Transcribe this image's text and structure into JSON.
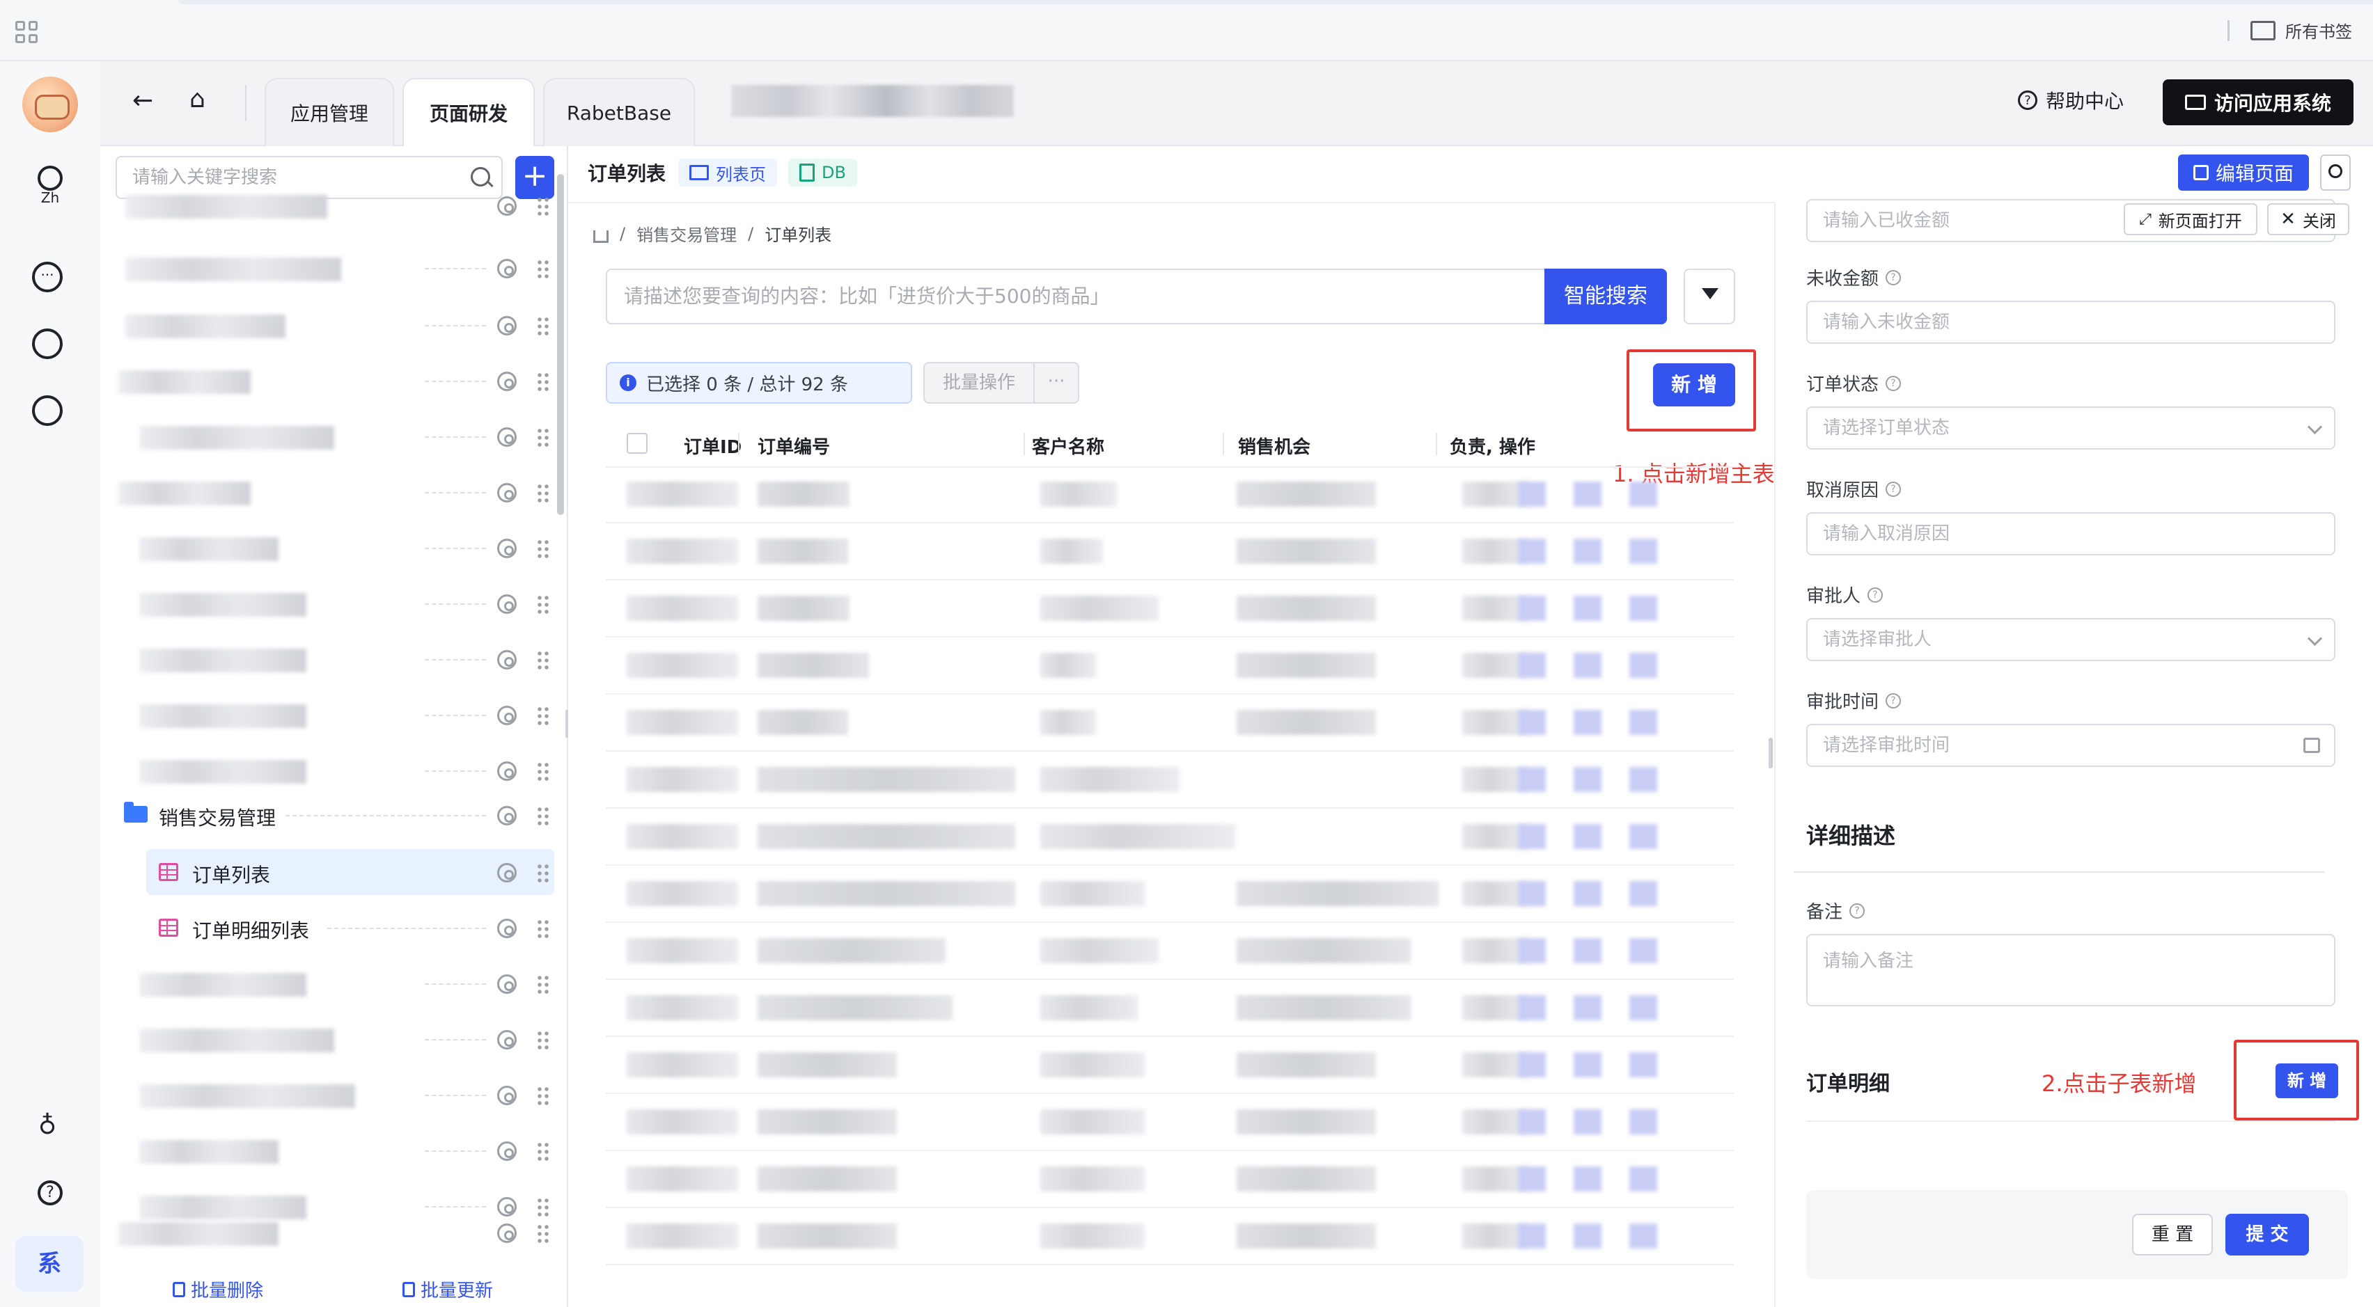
{
  "browser": {
    "bookmarks_label": "所有书签"
  },
  "rail": {
    "lang": "Zh",
    "bottom_label": "系"
  },
  "header": {
    "tabs": [
      {
        "label": "应用管理",
        "active": false
      },
      {
        "label": "页面研发",
        "active": true
      },
      {
        "label": "RabetBase",
        "active": false
      }
    ],
    "help_label": "帮助中心",
    "visit_label": "访问应用系统"
  },
  "tree": {
    "search_placeholder": "请输入关键字搜索",
    "group_label": "销售交易管理",
    "items": [
      {
        "label": "订单列表",
        "selected": true
      },
      {
        "label": "订单明细列表",
        "selected": false
      }
    ],
    "batch_delete_label": "批量删除",
    "batch_update_label": "批量更新"
  },
  "main": {
    "title": "订单列表",
    "tag_list": "列表页",
    "tag_db": "DB",
    "edit_label": "编辑页面",
    "breadcrumb": [
      "销售交易管理",
      "订单列表"
    ],
    "ai_search_placeholder": "请描述您要查询的内容：比如「进货价大于500的商品」",
    "ai_search_label": "智能搜索",
    "selection_info": "已选择 0 条 / 总计 92 条",
    "batch_op_label": "批量操作",
    "more_label": "···",
    "add_label": "新 增",
    "annotation_1": "1. 点击新增主表",
    "columns": [
      "订单ID",
      "订单编号",
      "客户名称",
      "销售机会",
      "负责, 操作"
    ]
  },
  "panel": {
    "newpage_label": "新页面打开",
    "close_label": "关闭",
    "fields": [
      {
        "label": "",
        "placeholder": "请输入已收金额",
        "kind": "text"
      },
      {
        "label": "未收金额",
        "placeholder": "请输入未收金额",
        "kind": "text"
      },
      {
        "label": "订单状态",
        "placeholder": "请选择订单状态",
        "kind": "select"
      },
      {
        "label": "取消原因",
        "placeholder": "请输入取消原因",
        "kind": "text"
      },
      {
        "label": "审批人",
        "placeholder": "请选择审批人",
        "kind": "select"
      },
      {
        "label": "审批时间",
        "placeholder": "请选择审批时间",
        "kind": "date"
      }
    ],
    "detail_section": "详细描述",
    "remark_label": "备注",
    "remark_placeholder": "请输入备注",
    "sub_section": "订单明细",
    "annotation_2": "2.点击子表新增",
    "sub_add_label": "新 增",
    "reset_label": "重 置",
    "submit_label": "提 交"
  }
}
